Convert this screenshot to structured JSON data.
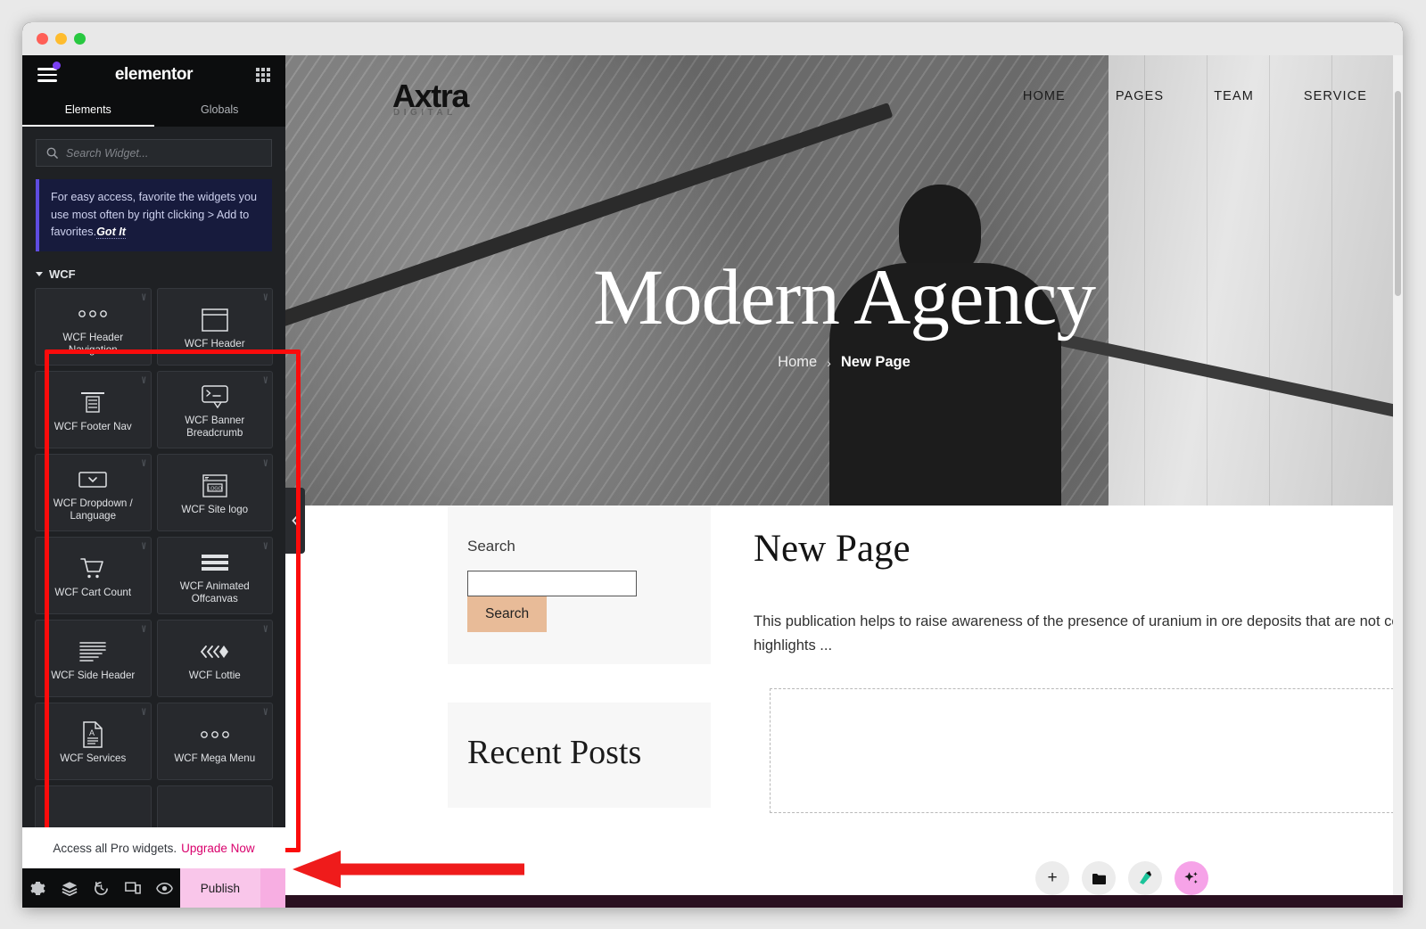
{
  "window": {
    "traffic_lights": [
      "close",
      "minimize",
      "maximize"
    ]
  },
  "panel": {
    "logo": "elementor",
    "menu_icon": "hamburger-icon",
    "grid_icon": "apps-grid-icon",
    "tabs": [
      {
        "label": "Elements",
        "active": true
      },
      {
        "label": "Globals",
        "active": false
      }
    ],
    "search": {
      "placeholder": "Search Widget...",
      "value": "",
      "icon": "search-icon"
    },
    "notice": {
      "text": "For easy access, favorite the widgets you use most often by right clicking > Add to favorites.",
      "link": "Got It"
    },
    "category": {
      "label": "WCF",
      "expanded": true
    },
    "widgets": [
      {
        "label": "WCF Header Navigation",
        "icon": "three-dots-icon",
        "pro": true
      },
      {
        "label": "WCF Header",
        "icon": "window-box-icon",
        "pro": true
      },
      {
        "label": "WCF Footer Nav",
        "icon": "footer-nav-icon",
        "pro": true
      },
      {
        "label": "WCF Banner Breadcrumb",
        "icon": "banner-breadcrumb-icon",
        "pro": true
      },
      {
        "label": "WCF Dropdown / Language",
        "icon": "dropdown-select-icon",
        "pro": true
      },
      {
        "label": "WCF Site logo",
        "icon": "site-logo-icon",
        "pro": true
      },
      {
        "label": "WCF Cart Count",
        "icon": "shopping-cart-icon",
        "pro": true
      },
      {
        "label": "WCF Animated Offcanvas",
        "icon": "hamburger-bars-icon",
        "pro": true
      },
      {
        "label": "WCF Side Header",
        "icon": "side-header-lines-icon",
        "pro": true
      },
      {
        "label": "WCF Lottie",
        "icon": "lottie-chevrons-icon",
        "pro": true
      },
      {
        "label": "WCF Services",
        "icon": "document-a-icon",
        "pro": true
      },
      {
        "label": "WCF Mega Menu",
        "icon": "three-dots-icon",
        "pro": true
      }
    ],
    "pro_strip": {
      "text": "Access all Pro widgets.",
      "link": "Upgrade Now"
    },
    "footer_buttons": [
      {
        "name": "settings",
        "icon": "gear-icon"
      },
      {
        "name": "navigator",
        "icon": "layers-icon"
      },
      {
        "name": "history",
        "icon": "history-clock-icon"
      },
      {
        "name": "responsive-mode",
        "icon": "devices-icon"
      },
      {
        "name": "preview",
        "icon": "eye-icon"
      }
    ],
    "publish": {
      "label": "Publish",
      "color": "#f9c6ea"
    },
    "collapse_icon": "chevron-left-icon"
  },
  "preview": {
    "site_logo": {
      "name": "Axtra",
      "tagline": "DIGITAL"
    },
    "nav": [
      "HOME",
      "PAGES",
      "TEAM",
      "SERVICE"
    ],
    "hero": {
      "title": "Modern Agency",
      "breadcrumb": {
        "home": "Home",
        "separator": "›",
        "current": "New Page"
      }
    },
    "sidebar": {
      "search_widget": {
        "title": "Search",
        "input_value": "",
        "button_label": "Search",
        "button_color": "#e8bb98"
      },
      "recent_posts_title": "Recent Posts"
    },
    "main": {
      "title": "New Page",
      "paragraph": "This publication helps to raise awareness of the presence of uranium in ore deposits that are not containing uranium and highlights ..."
    },
    "fabs": [
      {
        "name": "add-element",
        "icon": "plus-icon"
      },
      {
        "name": "folder-templates",
        "icon": "folder-icon"
      },
      {
        "name": "color-picker",
        "icon": "paint-icon"
      },
      {
        "name": "ai-assist",
        "icon": "sparkle-icon",
        "color": "#f6a3e8"
      }
    ]
  },
  "annotations": {
    "widget_grid_highlight_color": "#fb0b0b",
    "arrow_target": "publish-button",
    "arrow_color": "#ef1b1b"
  }
}
